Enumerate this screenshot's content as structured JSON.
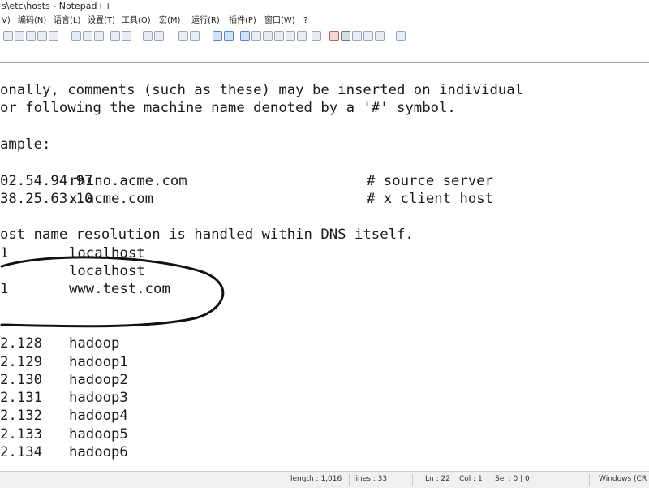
{
  "window": {
    "title": "s\\etc\\hosts - Notepad++"
  },
  "menu": {
    "items": [
      {
        "key": "view",
        "label": "V)"
      },
      {
        "key": "encoding",
        "label": "编码(N)"
      },
      {
        "key": "language",
        "label": "语言(L)"
      },
      {
        "key": "settings",
        "label": "设置(T)"
      },
      {
        "key": "tools",
        "label": "工具(O)"
      },
      {
        "key": "macro",
        "label": "宏(M)"
      },
      {
        "key": "run",
        "label": "运行(R)"
      },
      {
        "key": "plugins",
        "label": "插件(P)"
      },
      {
        "key": "window",
        "label": "窗口(W)"
      },
      {
        "key": "help",
        "label": "?"
      }
    ]
  },
  "toolbar": {
    "buttons": [
      {
        "name": "open-icon"
      },
      {
        "name": "save-icon"
      },
      {
        "name": "save-all-icon"
      },
      {
        "name": "close-icon"
      },
      {
        "name": "print-icon"
      },
      {
        "name": "cut-icon"
      },
      {
        "name": "copy-icon"
      },
      {
        "name": "paste-icon"
      },
      {
        "name": "undo-icon"
      },
      {
        "name": "redo-icon"
      },
      {
        "name": "find-icon"
      },
      {
        "name": "replace-icon"
      },
      {
        "name": "zoom-in-icon"
      },
      {
        "name": "zoom-out-icon"
      },
      {
        "name": "sync-vertical-icon"
      },
      {
        "name": "sync-horizontal-icon"
      },
      {
        "name": "word-wrap-icon"
      },
      {
        "name": "show-all-chars-icon"
      },
      {
        "name": "indent-guide-icon"
      },
      {
        "name": "doc-map-icon"
      },
      {
        "name": "function-list-icon"
      },
      {
        "name": "folder-workspace-icon"
      },
      {
        "name": "monitoring-icon"
      },
      {
        "name": "record-macro-icon"
      },
      {
        "name": "stop-record-icon"
      },
      {
        "name": "play-macro-icon"
      },
      {
        "name": "run-macro-multiple-icon"
      },
      {
        "name": "save-macro-icon"
      },
      {
        "name": "more-icon"
      }
    ]
  },
  "editor": {
    "lines": [
      {
        "text": "onally, comments (such as these) may be inserted on individual"
      },
      {
        "text": "or following the machine name denoted by a '#' symbol."
      },
      {
        "text": ""
      },
      {
        "text": "ample:"
      },
      {
        "text": ""
      },
      {
        "addr": "02.54.94.97",
        "host": "rhino.acme.com",
        "comment": "# source server"
      },
      {
        "addr": "38.25.63.10",
        "host": "x.acme.com",
        "comment": "# x client host"
      },
      {
        "text": ""
      },
      {
        "text": "ost name resolution is handled within DNS itself."
      },
      {
        "addr": "1",
        "host": "localhost"
      },
      {
        "addr": "",
        "host": "localhost"
      },
      {
        "addr": "1",
        "host": "www.test.com"
      },
      {
        "text": ""
      },
      {
        "text": ""
      },
      {
        "addr": "2.128",
        "host": "hadoop"
      },
      {
        "addr": "2.129",
        "host": "hadoop1"
      },
      {
        "addr": "2.130",
        "host": "hadoop2"
      },
      {
        "addr": "2.131",
        "host": "hadoop3"
      },
      {
        "addr": "2.132",
        "host": "hadoop4"
      },
      {
        "addr": "2.133",
        "host": "hadoop5"
      },
      {
        "addr": "2.134",
        "host": "hadoop6"
      }
    ]
  },
  "status": {
    "length": "length : 1,016",
    "lines": "lines : 33",
    "ln": "Ln : 22",
    "col": "Col : 1",
    "sel": "Sel : 0 | 0",
    "eol": "Windows (CR"
  },
  "colors": {
    "annotation": "#111111",
    "editor_bg": "#ffffff",
    "text": "#1a1a1a"
  }
}
